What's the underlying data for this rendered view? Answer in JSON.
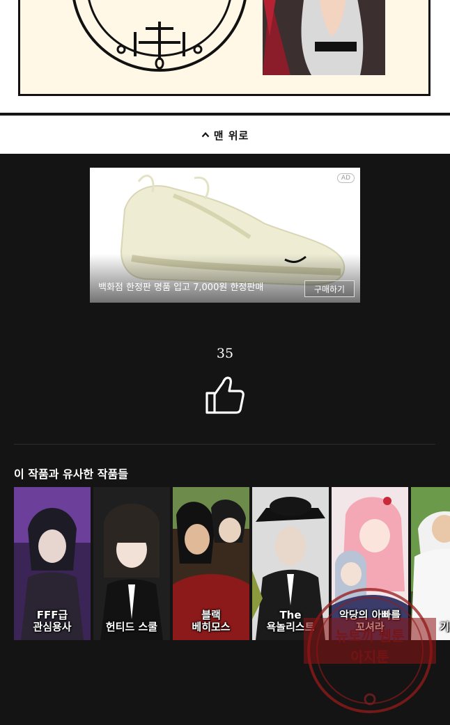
{
  "top_nav": {
    "label": "맨 위로"
  },
  "ad": {
    "badge": "AD",
    "caption": "백화점 한정판 명품 입고 7,000원 한정판매",
    "button": "구매하기"
  },
  "likes": {
    "count": "35"
  },
  "similar": {
    "title": "이 작품과 유사한 작품들",
    "items": [
      {
        "title": "FFF급\n관심용사",
        "color": "#4a2f6e"
      },
      {
        "title": "헌티드 스쿨",
        "color": "#2b2b2b"
      },
      {
        "title": "블랙\n베히모스",
        "color": "#6a2a1e"
      },
      {
        "title": "The\n욕놀리스트",
        "color": "#3a3a3a"
      },
      {
        "title": "악당의 아빠를\n꼬셔라",
        "color": "#c98a92"
      },
      {
        "title": "기프",
        "color": "#5d8a3e"
      }
    ]
  },
  "watermark": {
    "line1": "뉴토끼 웹툰",
    "line2": "아지툰"
  }
}
